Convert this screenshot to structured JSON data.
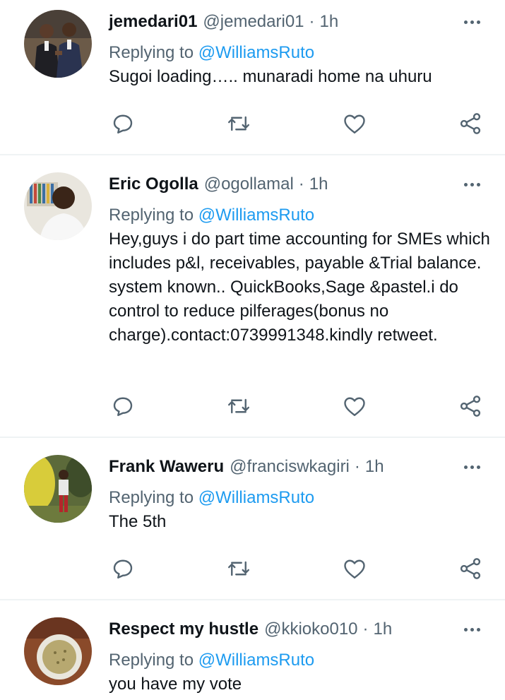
{
  "tweets": [
    {
      "display_name": "jemedari01",
      "handle": "@jemedari01",
      "separator": "·",
      "time": "1h",
      "replying_prefix": "Replying to",
      "replying_to": "@WilliamsRuto",
      "text": "Sugoi loading….. munaradi home na uhuru"
    },
    {
      "display_name": "Eric Ogolla",
      "handle": "@ogollamal",
      "separator": "·",
      "time": "1h",
      "replying_prefix": "Replying to",
      "replying_to": "@WilliamsRuto",
      "text": "Hey,guys i do part time accounting for SMEs which includes p&l, receivables, payable &Trial balance. system known.. QuickBooks,Sage &pastel.i do control to reduce pilferages(bonus no charge).contact:0739991348.kindly retweet."
    },
    {
      "display_name": "Frank Waweru",
      "handle": "@franciswkagiri",
      "separator": "·",
      "time": "1h",
      "replying_prefix": "Replying to",
      "replying_to": "@WilliamsRuto",
      "text": "The 5th"
    },
    {
      "display_name": "Respect my hustle",
      "handle": "@kkioko010",
      "separator": "·",
      "time": "1h",
      "replying_prefix": "Replying to",
      "replying_to": "@WilliamsRuto",
      "text": "you have my vote"
    }
  ],
  "icons": {
    "more": "more-horizontal-icon",
    "reply": "reply-bubble-icon",
    "retweet": "retweet-icon",
    "like": "heart-icon",
    "share": "share-icon"
  },
  "colors": {
    "text": "#0f1419",
    "secondary": "#536471",
    "mention": "#1d9bf0",
    "divider": "#eff3f4"
  }
}
